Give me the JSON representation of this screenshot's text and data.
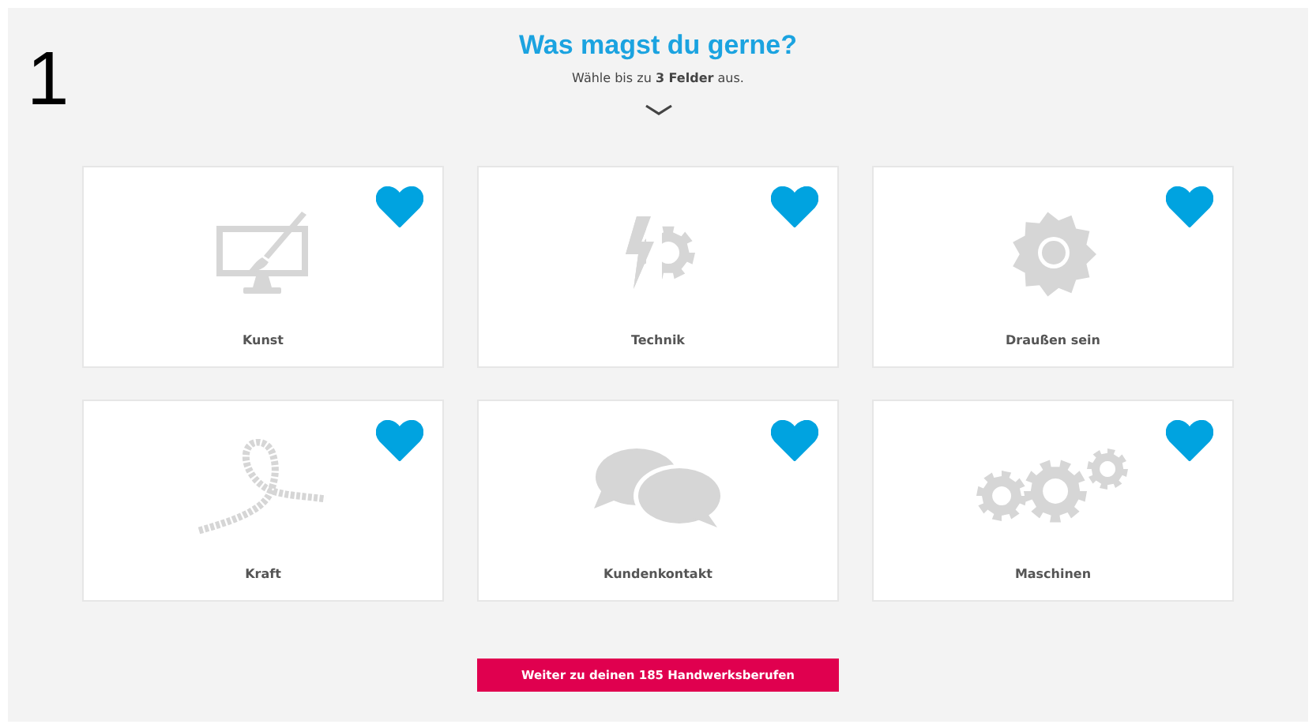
{
  "step_number": "1",
  "header": {
    "title": "Was magst du gerne?",
    "subtitle": "Wähle bis zu **3 Felder** aus."
  },
  "cards": [
    {
      "label": "Kunst",
      "kind": "art",
      "liked": true
    },
    {
      "label": "Technik",
      "kind": "tech",
      "liked": true
    },
    {
      "label": "Draußen sein",
      "kind": "sun",
      "liked": true
    },
    {
      "label": "Kraft",
      "kind": "rope",
      "liked": true
    },
    {
      "label": "Kundenkontakt",
      "kind": "chat",
      "liked": true
    },
    {
      "label": "Maschinen",
      "kind": "gears",
      "liked": true
    }
  ],
  "continue_button": "Weiter zu deinen 185 Handwerksberufen"
}
